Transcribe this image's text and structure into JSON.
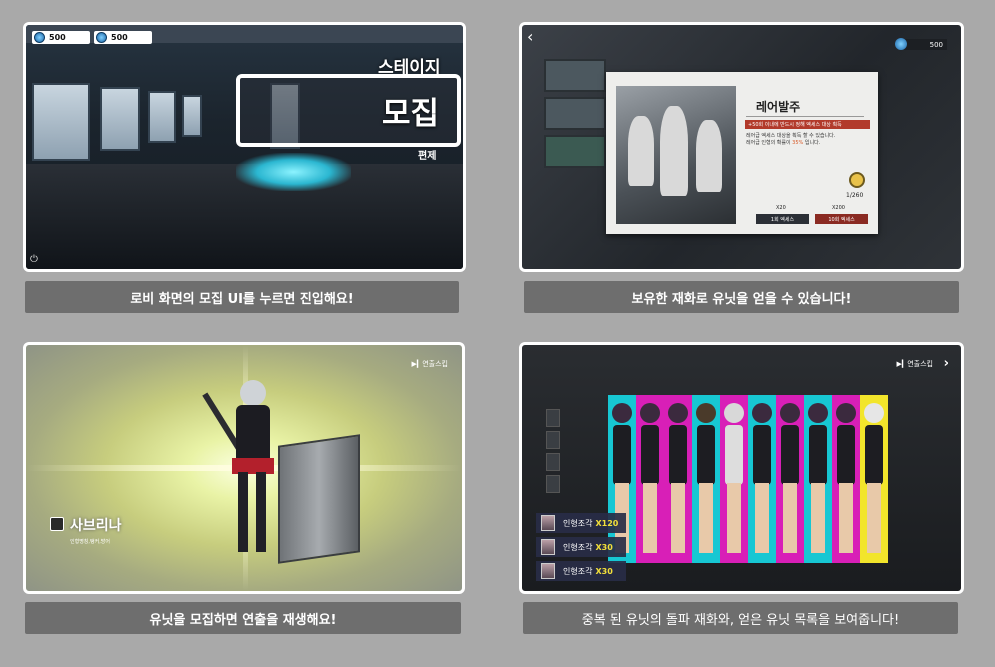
{
  "colors": {
    "background": "#a9a9a9",
    "caption_bg": "#6e6e6e",
    "accent_red": "#b23a2b",
    "highlight_yellow": "#f3e03a"
  },
  "panel1": {
    "currency": [
      {
        "icon": "gem-icon",
        "value": "500"
      },
      {
        "icon": "gem-icon",
        "value": "500"
      }
    ],
    "stage_label": "스테이지",
    "recruit_label": "모집",
    "sub_label": "편제",
    "caption": "로비 화면의 모집 UI를 누르면 진입해요!"
  },
  "panel2": {
    "currency": "500",
    "card": {
      "title": "레어발주",
      "banner": "+50회 이내에 반드시 정해 엑세스 대상 획득",
      "desc1": "레어급 엑세스 대상을 획득 할 수 있습니다.",
      "desc2_pre": "레어급 인형의 확률이 ",
      "desc2_hi": "35%",
      "desc2_post": " 입니다.",
      "counter": "1/260",
      "cost1": "X20",
      "cost2": "X200",
      "btn1": "1회 엑세스",
      "btn2": "10회 엑세스"
    },
    "caption": "보유한 재화로 유닛을 얻을 수 있습니다!"
  },
  "panel3": {
    "skip": "연출스킵",
    "unit_name": "사브리나",
    "unit_role": "인형명칭,탱커,방어",
    "caption": "유닛을 모집하면 연출을 재생해요!"
  },
  "panel4": {
    "skip": "연출스킵",
    "rewards": [
      {
        "label": "인형조각",
        "qty": "X120"
      },
      {
        "label": "인형조각",
        "qty": "X30"
      },
      {
        "label": "인형조각",
        "qty": "X30"
      }
    ],
    "caption": "중복 된 유닛의 돌파 재화와, 얻은 유닛 목록을 보여줍니다!"
  }
}
